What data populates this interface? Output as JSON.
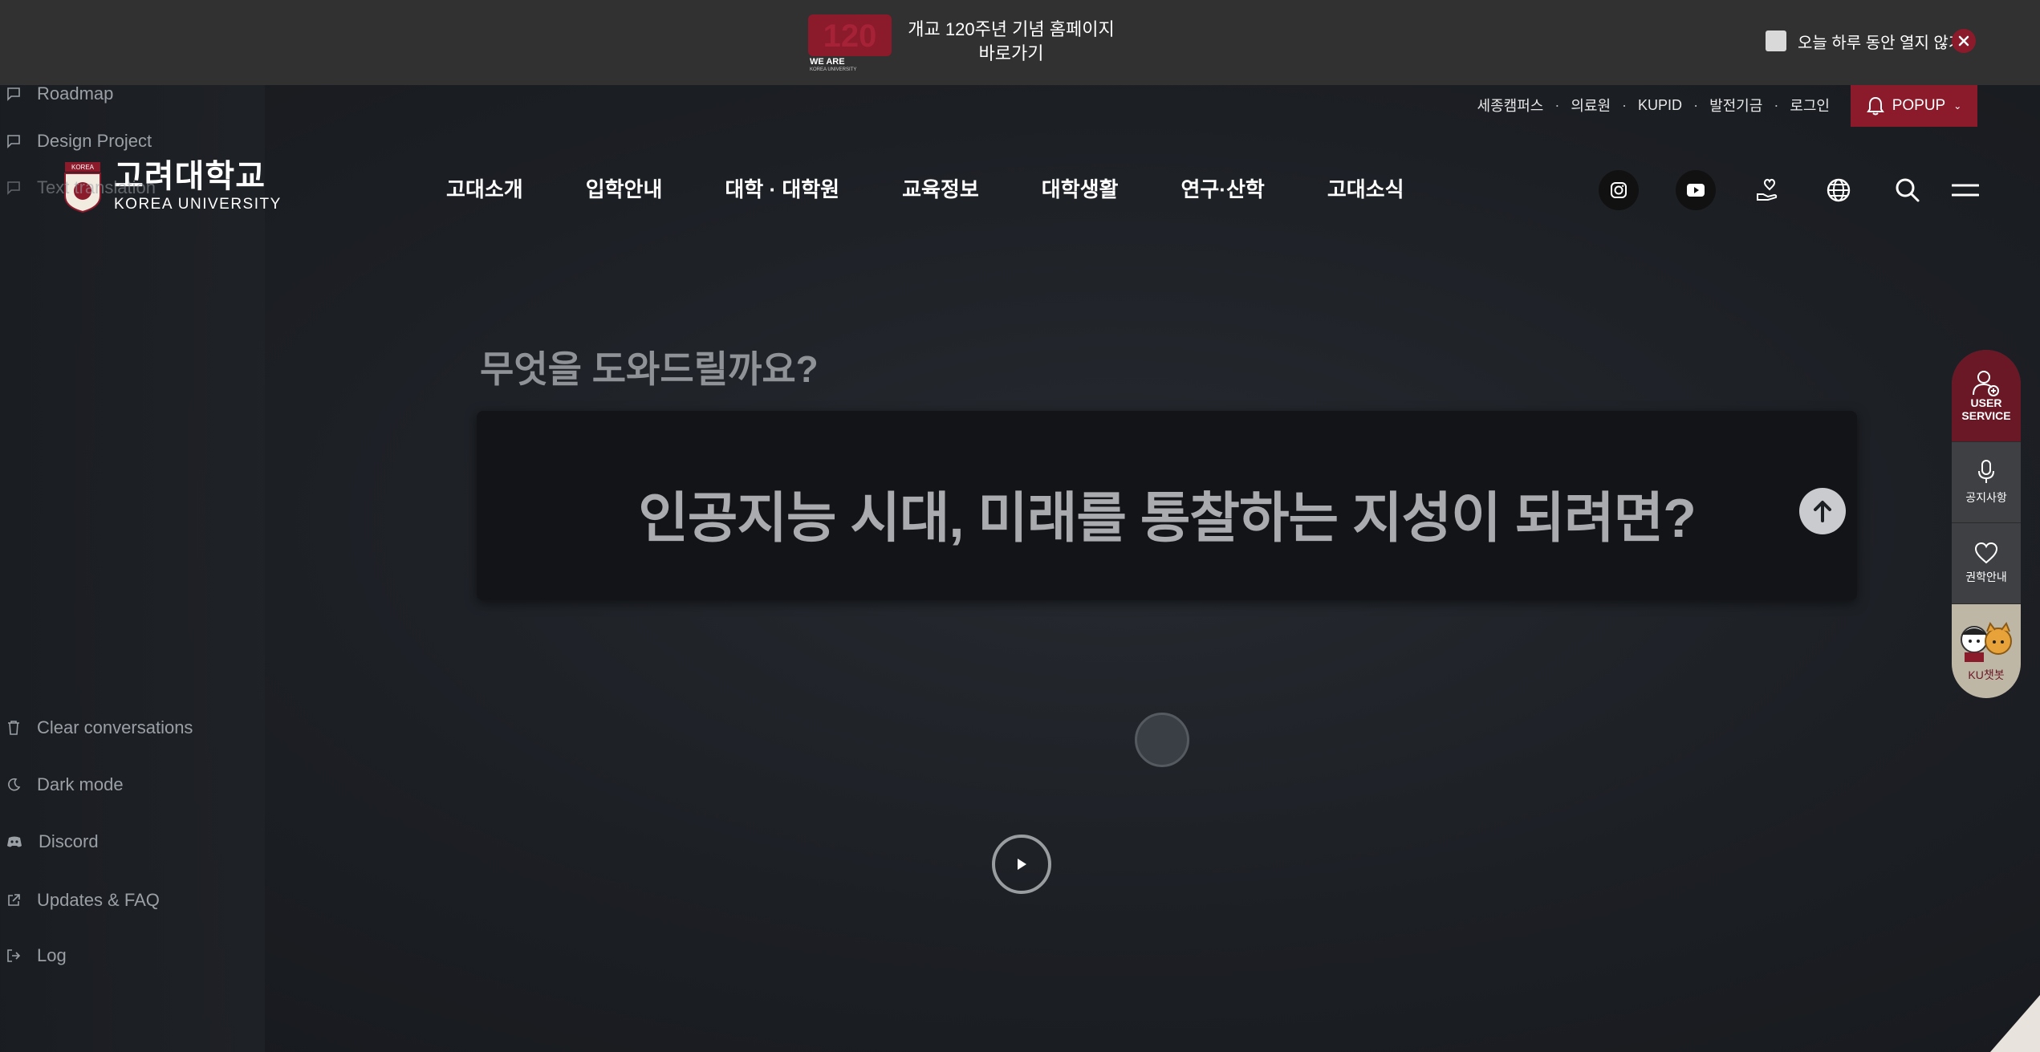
{
  "banner": {
    "logo_text": "WE ARE",
    "logo_subtext": "KOREA UNIVERSITY",
    "text_line1": "개교 120주년 기념 홈페이지",
    "text_line2": "바로가기",
    "dont_show_label": "오늘 하루 동안 열지 않기"
  },
  "utility": {
    "links": [
      "세종캠퍼스",
      "의료원",
      "KUPID",
      "발전기금",
      "로그인"
    ],
    "popup_label": "POPUP"
  },
  "logo": {
    "korean": "고려대학교",
    "english": "KOREA UNIVERSITY"
  },
  "nav": [
    "고대소개",
    "입학안내",
    "대학 · 대학원",
    "교육정보",
    "대학생활",
    "연구·산학",
    "고대소식"
  ],
  "sidebar": {
    "top": [
      "Roadmap",
      "Design Project",
      "Text translation"
    ],
    "bottom": [
      "Clear conversations",
      "Dark mode",
      "Discord",
      "Updates & FAQ",
      "Log"
    ]
  },
  "main": {
    "heading": "무엇을 도와드릴까요?",
    "question": "인공지능 시대, 미래를 통찰하는 지성이 되려면?"
  },
  "quick_menu": {
    "user_service": [
      "USER",
      "SERVICE"
    ],
    "notice": "공지사항",
    "donation": "권학안내",
    "chatbot": "KU챗봇"
  },
  "colors": {
    "brand": "#8b1a2b",
    "background": "#1c1f24",
    "banner": "#313131"
  }
}
